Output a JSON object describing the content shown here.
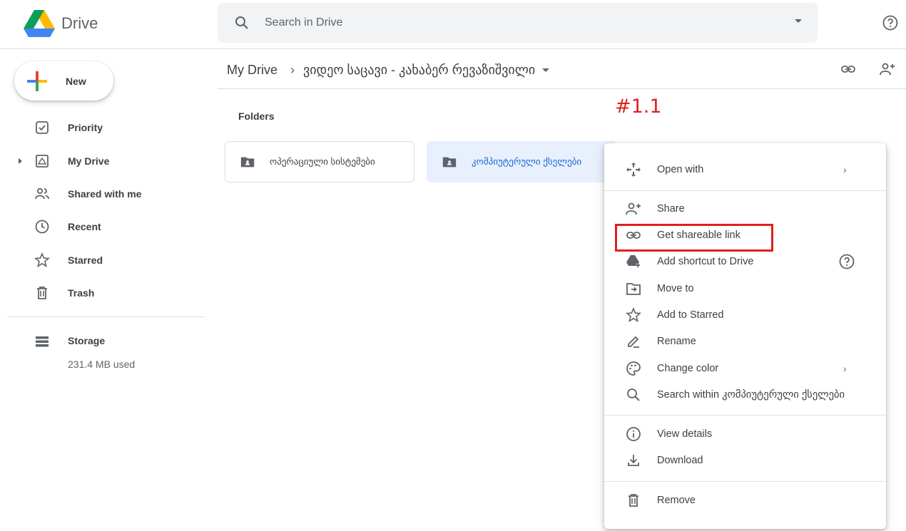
{
  "app": {
    "name": "Drive"
  },
  "search": {
    "placeholder": "Search in Drive"
  },
  "sidebar": {
    "new_label": "New",
    "items": [
      {
        "label": "Priority",
        "icon": "priority-icon"
      },
      {
        "label": "My Drive",
        "icon": "my-drive-icon"
      },
      {
        "label": "Shared with me",
        "icon": "shared-icon"
      },
      {
        "label": "Recent",
        "icon": "clock-icon"
      },
      {
        "label": "Starred",
        "icon": "star-icon"
      },
      {
        "label": "Trash",
        "icon": "trash-icon"
      }
    ],
    "storage_label": "Storage",
    "storage_used": "231.4 MB used"
  },
  "breadcrumb": {
    "root": "My Drive",
    "separator": "›",
    "current": "ვიდეო საცავი - კახაბერ რევაზიშვილი"
  },
  "annotation": "#1.1",
  "folders": {
    "label": "Folders",
    "items": [
      {
        "name": "ოპერაციული სისტემები"
      },
      {
        "name": "კომპიუტერული ქსელები"
      }
    ]
  },
  "context_menu": {
    "open_with": "Open with",
    "share": "Share",
    "get_link": "Get shareable link",
    "add_shortcut": "Add shortcut to Drive",
    "move_to": "Move to",
    "add_starred": "Add to Starred",
    "rename": "Rename",
    "change_color": "Change color",
    "search_within": "Search within კომპიუტერული ქსელები",
    "view_details": "View details",
    "download": "Download",
    "remove": "Remove",
    "chevron": "›"
  },
  "colors": {
    "accent": "#1967d2",
    "annotation_red": "#e0201f",
    "selected_bg": "#e8f0fe"
  }
}
